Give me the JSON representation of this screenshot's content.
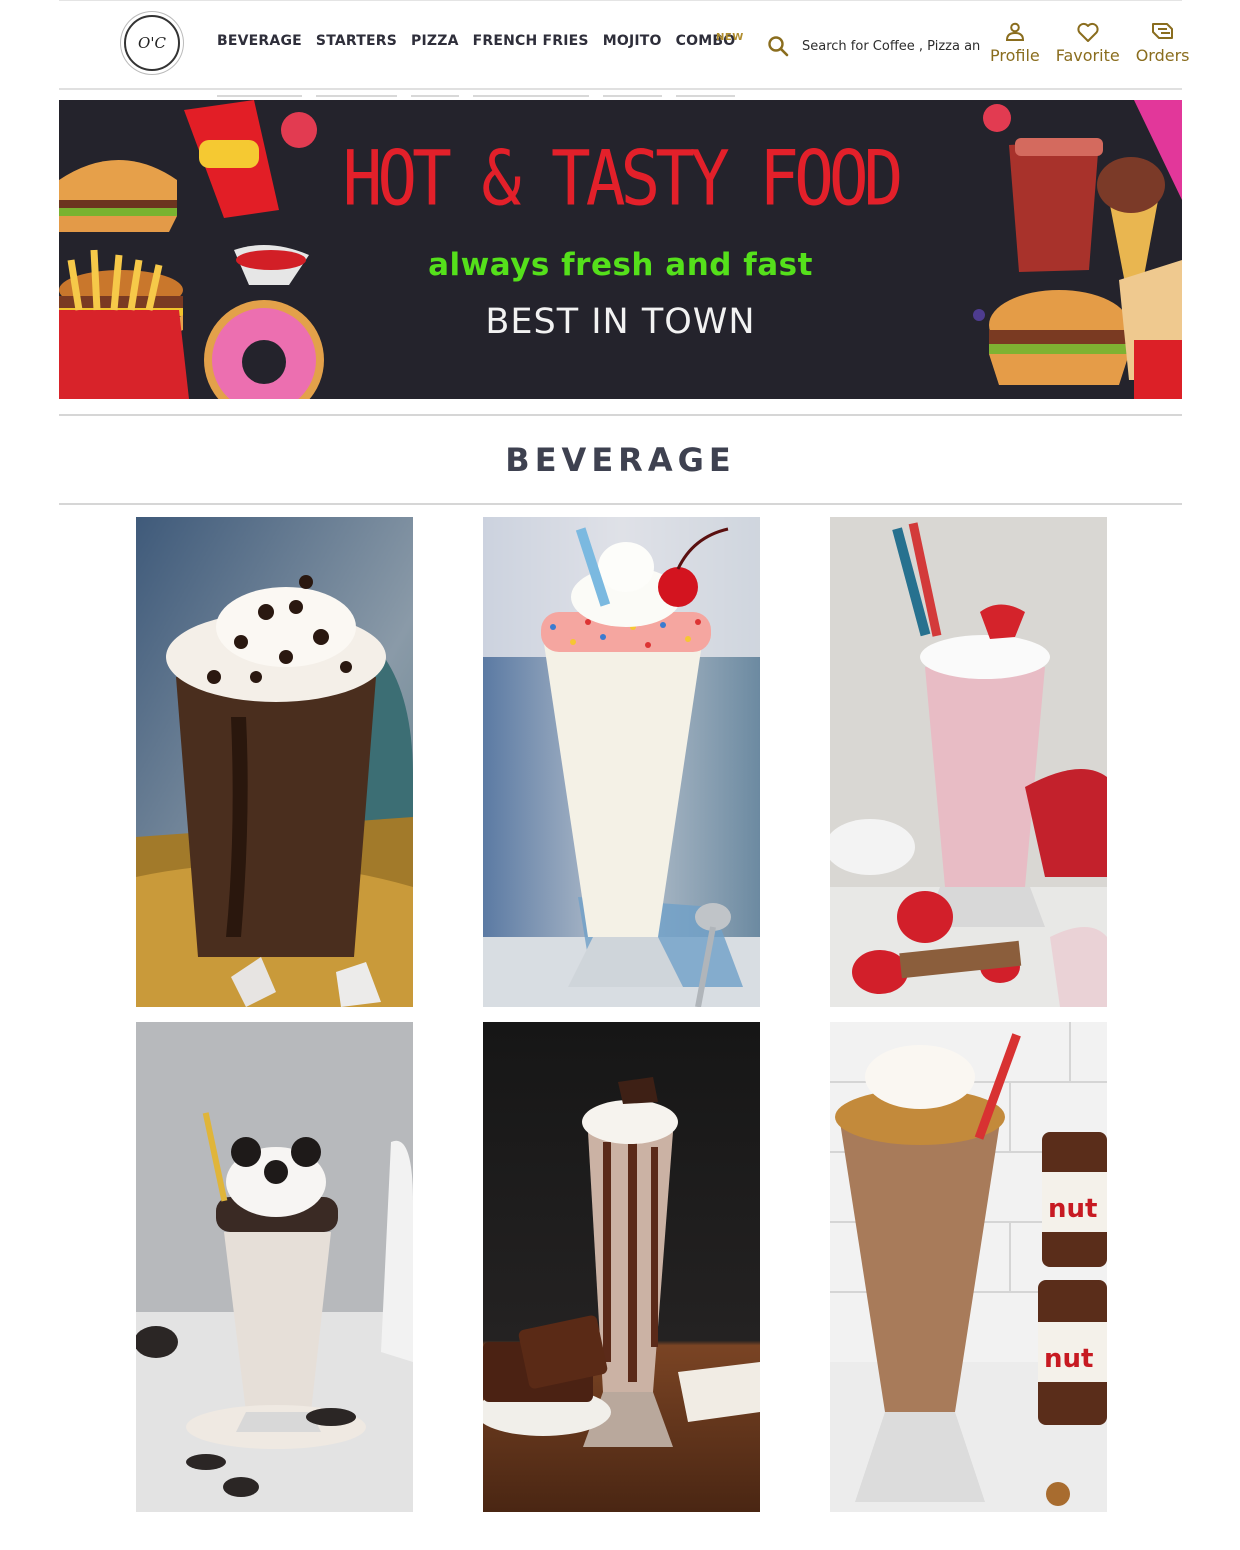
{
  "header": {
    "logo_text": "O'C",
    "nav": [
      {
        "label": "BEVERAGE"
      },
      {
        "label": "STARTERS"
      },
      {
        "label": "PIZZA"
      },
      {
        "label": "FRENCH FRIES"
      },
      {
        "label": "MOJITO"
      },
      {
        "label": "COMBO"
      }
    ],
    "new_badge": "NEW",
    "search": {
      "placeholder": "Search for Coffee , Pizza and more"
    },
    "actions": {
      "profile": "Profile",
      "favorite": "Favorite",
      "orders": "Orders"
    }
  },
  "banner": {
    "headline": "HOT & TASTY FOOD",
    "tagline": "always fresh and fast",
    "subline": "BEST IN TOWN"
  },
  "section": {
    "title": "BEVERAGE"
  },
  "products": [
    {
      "name": "chocolate-chip-frappe"
    },
    {
      "name": "vanilla-milkshake"
    },
    {
      "name": "strawberry-milkshake"
    },
    {
      "name": "oreo-milkshake"
    },
    {
      "name": "brownie-milkshake"
    },
    {
      "name": "nutella-milkshake"
    }
  ],
  "colors": {
    "accent": "#8a6d1e",
    "nav_text": "#2e2e3a",
    "banner_bg": "#24232c",
    "banner_headline": "#e3202a",
    "banner_tagline": "#55e01b",
    "section_title": "#3e4150"
  }
}
